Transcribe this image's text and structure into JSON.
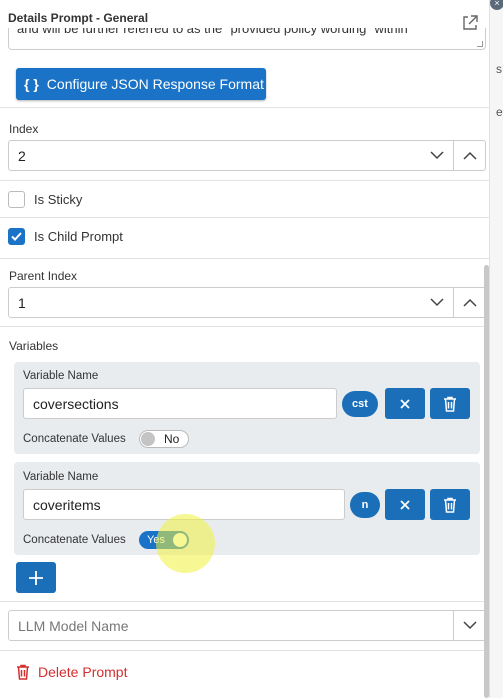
{
  "header": {
    "title": "Details Prompt - General"
  },
  "prompt_text": {
    "visible_fragment": "and will be further referred to as the \"provided policy wording\" within"
  },
  "configure_button": {
    "braces": "{ }",
    "label": "Configure JSON Response Format"
  },
  "index": {
    "label": "Index",
    "value": "2"
  },
  "is_sticky": {
    "label": "Is Sticky",
    "checked": false
  },
  "is_child_prompt": {
    "label": "Is Child Prompt",
    "checked": true
  },
  "parent_index": {
    "label": "Parent Index",
    "value": "1"
  },
  "variables": {
    "label": "Variables",
    "items": [
      {
        "name_label": "Variable Name",
        "name_value": "coversections",
        "abbr": "cst",
        "concat_label": "Concatenate Values",
        "concat_state": "No",
        "concat_on": false
      },
      {
        "name_label": "Variable Name",
        "name_value": "coveritems",
        "abbr": "n",
        "concat_label": "Concatenate Values",
        "concat_state": "Yes",
        "concat_on": true
      }
    ]
  },
  "llm_model": {
    "placeholder": "LLM Model Name"
  },
  "delete_prompt": {
    "label": "Delete Prompt"
  },
  "background": {
    "letters": [
      "s",
      "e"
    ]
  },
  "colors": {
    "primary": "#1a73c6",
    "danger": "#d32f2f",
    "card_bg": "#e9ecef"
  },
  "icons": [
    "external-link-icon",
    "chevron-down-icon",
    "chevron-up-icon",
    "close-icon",
    "trash-icon",
    "plus-icon",
    "checkmark-icon"
  ]
}
